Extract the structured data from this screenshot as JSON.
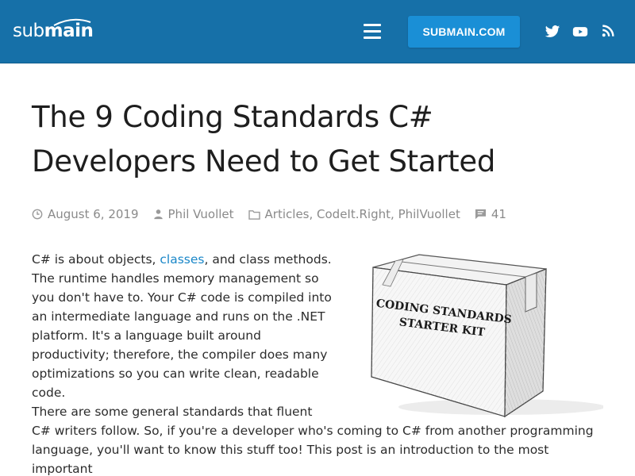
{
  "header": {
    "logo_light": "sub",
    "logo_bold": "main",
    "cta_label": "SUBMAIN.COM",
    "menu_icon": "hamburger-menu-icon",
    "social_icons": [
      "twitter-icon",
      "youtube-icon",
      "rss-icon"
    ],
    "background": "#1670a8",
    "cta_color": "#1a8fd6"
  },
  "post": {
    "title": "The 9 Coding Standards C# Developers Need to Get Started",
    "meta": {
      "date": "August 6, 2019",
      "author": "Phil Vuollet",
      "categories": [
        "Articles",
        "CodeIt.Right",
        "PhilVuollet"
      ],
      "category_separator": ", ",
      "comments": "41"
    },
    "p1_before": "C# is about objects, ",
    "p1_link": "classes",
    "p1_after": ", and class methods. The runtime handles memory management so you don't have to. Your C# code is compiled into an intermediate language and runs on the .NET platform. It's a language built around productivity; therefore, the compiler does many optimizations so you can write clean, readable code.",
    "p2": "There are some general standards that fluent C# writers follow. So, if you're a developer who's coming to C# from another programming language, you'll want to know this stuff too! This post is an introduction to the most important",
    "figure": {
      "box_label_line1": "CODING STANDARDS",
      "box_label_line2": "STARTER KIT"
    },
    "link_color": "#1a87c8"
  }
}
